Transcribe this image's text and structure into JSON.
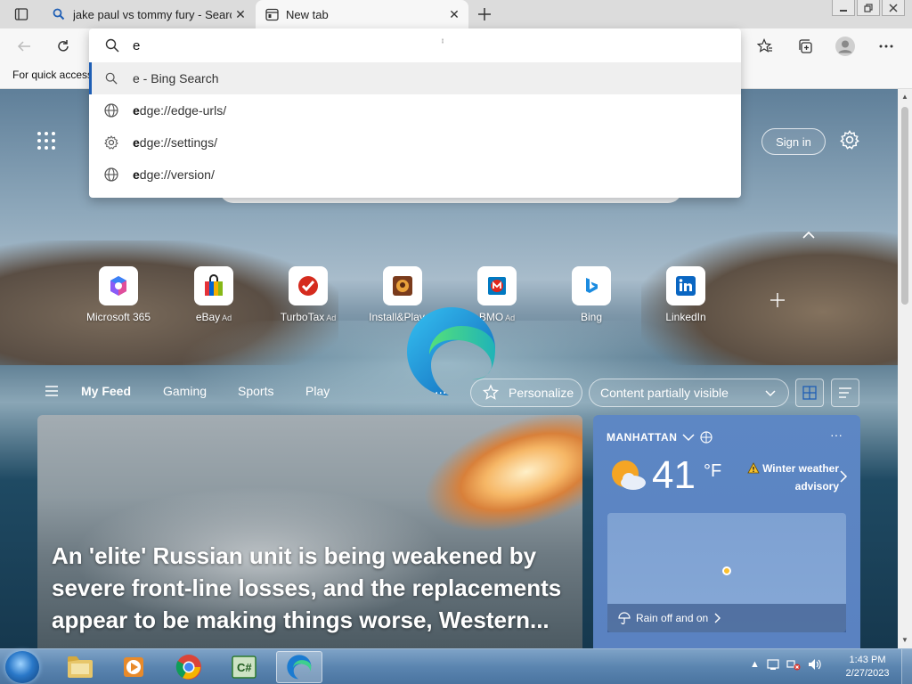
{
  "tabs": [
    {
      "title": "jake paul vs tommy fury - Search",
      "active": false,
      "icon": "search-icon"
    },
    {
      "title": "New tab",
      "active": true,
      "icon": "newtab-icon"
    }
  ],
  "favorites_bar": {
    "hint": "For quick access"
  },
  "omnibox": {
    "value": "e",
    "suggestions": [
      {
        "bold": "e",
        "rest": " - Bing Search",
        "icon": "search-icon"
      },
      {
        "bold": "e",
        "rest": "dge://edge-urls/",
        "icon": "globe-icon"
      },
      {
        "bold": "e",
        "rest": "dge://settings/",
        "icon": "gear-icon"
      },
      {
        "bold": "e",
        "rest": "dge://version/",
        "icon": "globe-icon"
      }
    ]
  },
  "header": {
    "signin_label": "Sign in"
  },
  "quick_links": [
    {
      "label": "Microsoft 365",
      "ad": ""
    },
    {
      "label": "eBay",
      "ad": "Ad"
    },
    {
      "label": "TurboTax",
      "ad": "Ad"
    },
    {
      "label": "Install&Play",
      "ad": "Ad"
    },
    {
      "label": "BMO",
      "ad": "Ad"
    },
    {
      "label": "Bing",
      "ad": ""
    },
    {
      "label": "LinkedIn",
      "ad": ""
    }
  ],
  "feed": {
    "tabs": [
      "My Feed",
      "Gaming",
      "Sports",
      "Play"
    ],
    "more": "...",
    "personalize_label": "Personalize",
    "content_visibility": "Content partially visible"
  },
  "hero": {
    "title": "An 'elite' Russian unit is being weakened by severe front-line losses, and the replacements appear to be making things worse, Western..."
  },
  "weather": {
    "location": "MANHATTAN",
    "temperature": "41",
    "unit": "°F",
    "alert": "Winter weather advisory",
    "more": "···",
    "forecast": "Rain off and on"
  },
  "taskbar": {
    "time": "1:43 PM",
    "date": "2/27/2023"
  },
  "colors": {
    "accent": "#1f5fb5",
    "weather_card": "#5d87c4"
  }
}
